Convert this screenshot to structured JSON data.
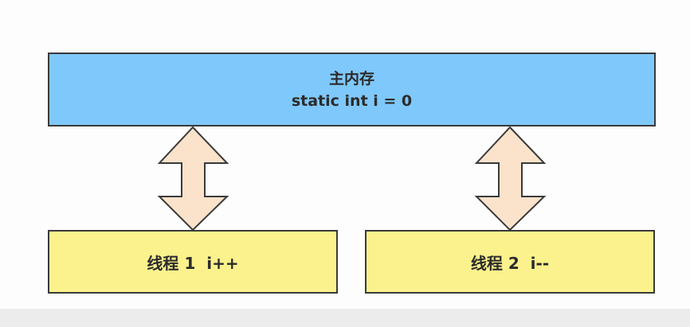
{
  "main_memory": {
    "title": "主内存",
    "code": "static int i = 0",
    "color": "#7fc8fb"
  },
  "threads": [
    {
      "label": "线程 1  i++",
      "color": "#fbf28e"
    },
    {
      "label": "线程 2  i--",
      "color": "#fbf28e"
    }
  ],
  "arrow_color": "#fbe3cb"
}
